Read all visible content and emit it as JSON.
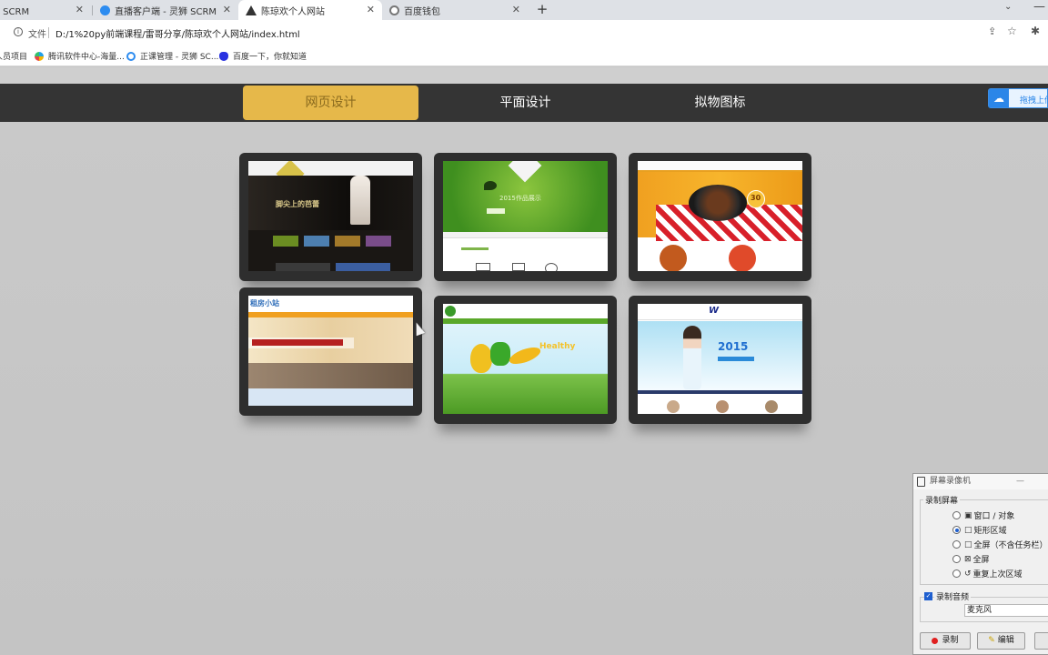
{
  "browser": {
    "tabs": [
      {
        "title": "灵狮 SCRM",
        "active": false,
        "icon_color": "#e55a2b"
      },
      {
        "title": "直播客户端 - 灵狮 SCRM",
        "active": false,
        "icon_color": "#2d8cf0"
      },
      {
        "title": "陈琼欢个人网站",
        "active": true,
        "icon_color": "#333333"
      },
      {
        "title": "百度钱包",
        "active": false,
        "icon_color": "#777777"
      }
    ],
    "close_glyph": "✕",
    "newtab_glyph": "+",
    "address": {
      "scheme_label": "文件",
      "url": "D:/1%20py前端课程/雷哥分享/陈琼欢个人网站/index.html"
    },
    "bookmarks": [
      {
        "label": "人员项目",
        "icon_color": ""
      },
      {
        "label": "腾讯软件中心-海量...",
        "icon_color": "#22a0e8"
      },
      {
        "label": "正课管理 - 灵狮 SC...",
        "icon_color": "#2d8cf0"
      },
      {
        "label": "百度一下，你就知道",
        "icon_color": "#2932e1"
      }
    ]
  },
  "site": {
    "nav": [
      {
        "label": "网页设计",
        "active": true
      },
      {
        "label": "平面设计",
        "active": false
      },
      {
        "label": "拟物图标",
        "active": false
      }
    ],
    "upload_label": "拖拽上传",
    "nav_active_color": "#e6b84a",
    "nav_bg_color": "#343434",
    "gallery": [
      {
        "name": "ballet",
        "text": "脚尖上的芭蕾"
      },
      {
        "name": "green",
        "text": "2015作品展示"
      },
      {
        "name": "food",
        "text": "30"
      },
      {
        "name": "rental",
        "text": "租房小站"
      },
      {
        "name": "organic",
        "text": "Healthy"
      },
      {
        "name": "event",
        "text": "2015"
      }
    ]
  },
  "recorder": {
    "title": "屏幕录像机",
    "section_screen": "录制屏幕",
    "options": [
      {
        "label": "窗口 / 对象",
        "selected": false
      },
      {
        "label": "矩形区域",
        "selected": true
      },
      {
        "label": "全屏（不含任务栏）",
        "selected": false
      },
      {
        "label": "全屏",
        "selected": false
      },
      {
        "label": "重复上次区域",
        "selected": false
      }
    ],
    "section_audio": "录制音频",
    "audio_source": "麦克风",
    "record_label": "录制",
    "edit_label": "编辑"
  }
}
